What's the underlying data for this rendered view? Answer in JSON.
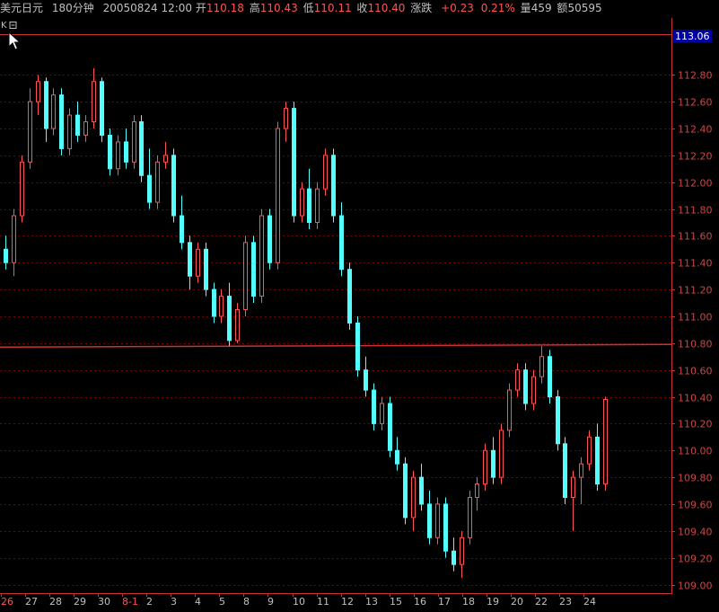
{
  "header": {
    "instrument": "美元日元",
    "period": "180分钟",
    "datetime": "20050824 12:00",
    "open_label": "开",
    "open": "110.18",
    "high_label": "高",
    "high": "110.43",
    "low_label": "低",
    "low": "110.11",
    "close_label": "收",
    "close": "110.40",
    "change_label": "涨跌",
    "change": "+0.23",
    "change_pct": "0.21%",
    "volume_label": "量",
    "volume": "459",
    "amount_label": "额",
    "amount": "50595"
  },
  "toolbar": {
    "k_label": "K",
    "collapse_icon": "minus-box-icon"
  },
  "colors": {
    "up": "#ff5454",
    "down": "#54ffff",
    "grid": "#7a0000",
    "axis": "#c83232",
    "badge_bg": "#0000a0"
  },
  "chart_data": {
    "type": "candlestick",
    "title": "美元日元 180分钟",
    "ylim": [
      108.97,
      113.09
    ],
    "y_ticks": [
      "113.06",
      "112.80",
      "112.60",
      "112.40",
      "112.20",
      "112.00",
      "111.80",
      "111.60",
      "111.40",
      "111.20",
      "111.00",
      "110.80",
      "110.60",
      "110.40",
      "110.20",
      "110.00",
      "109.80",
      "109.60",
      "109.40",
      "109.20",
      "109.00"
    ],
    "current_price_badge": "113.06",
    "x_date_labels": [
      {
        "label": "26",
        "red": true
      },
      {
        "label": "27"
      },
      {
        "label": "28"
      },
      {
        "label": "29"
      },
      {
        "label": "30"
      },
      {
        "label": "8-1",
        "red": true
      },
      {
        "label": "2"
      },
      {
        "label": "3"
      },
      {
        "label": "4"
      },
      {
        "label": "5"
      },
      {
        "label": "8"
      },
      {
        "label": "9"
      },
      {
        "label": "10"
      },
      {
        "label": "11"
      },
      {
        "label": "12"
      },
      {
        "label": "13"
      },
      {
        "label": "15"
      },
      {
        "label": "16"
      },
      {
        "label": "17"
      },
      {
        "label": "18"
      },
      {
        "label": "19"
      },
      {
        "label": "20"
      },
      {
        "label": "22"
      },
      {
        "label": "23"
      },
      {
        "label": "24"
      }
    ],
    "horizontal_line": 110.77,
    "candles": [
      [
        111.5,
        111.6,
        111.35,
        111.4
      ],
      [
        111.4,
        111.8,
        111.3,
        111.75
      ],
      [
        111.75,
        112.2,
        111.7,
        112.15
      ],
      [
        112.15,
        112.7,
        112.1,
        112.6
      ],
      [
        112.6,
        112.8,
        112.5,
        112.75
      ],
      [
        112.75,
        112.78,
        112.3,
        112.4
      ],
      [
        112.4,
        112.7,
        112.35,
        112.65
      ],
      [
        112.65,
        112.7,
        112.2,
        112.25
      ],
      [
        112.25,
        112.55,
        112.2,
        112.5
      ],
      [
        112.5,
        112.6,
        112.3,
        112.35
      ],
      [
        112.35,
        112.5,
        112.3,
        112.45
      ],
      [
        112.45,
        112.85,
        112.4,
        112.75
      ],
      [
        112.75,
        112.78,
        112.3,
        112.35
      ],
      [
        112.35,
        112.4,
        112.05,
        112.1
      ],
      [
        112.1,
        112.35,
        112.05,
        112.3
      ],
      [
        112.3,
        112.4,
        112.1,
        112.15
      ],
      [
        112.15,
        112.5,
        112.1,
        112.45
      ],
      [
        112.45,
        112.5,
        112.0,
        112.05
      ],
      [
        112.05,
        112.25,
        111.8,
        111.85
      ],
      [
        111.85,
        112.2,
        111.8,
        112.15
      ],
      [
        112.15,
        112.3,
        112.1,
        112.2
      ],
      [
        112.2,
        112.25,
        111.7,
        111.75
      ],
      [
        111.75,
        111.9,
        111.5,
        111.55
      ],
      [
        111.55,
        111.6,
        111.2,
        111.3
      ],
      [
        111.3,
        111.55,
        111.25,
        111.5
      ],
      [
        111.5,
        111.55,
        111.15,
        111.2
      ],
      [
        111.2,
        111.25,
        110.95,
        111.0
      ],
      [
        111.0,
        111.2,
        110.95,
        111.15
      ],
      [
        111.15,
        111.25,
        110.78,
        110.82
      ],
      [
        110.82,
        111.1,
        110.8,
        111.05
      ],
      [
        111.05,
        111.6,
        111.0,
        111.55
      ],
      [
        111.55,
        111.6,
        111.1,
        111.15
      ],
      [
        111.15,
        111.8,
        111.1,
        111.75
      ],
      [
        111.75,
        111.8,
        111.35,
        111.4
      ],
      [
        111.4,
        112.45,
        111.35,
        112.4
      ],
      [
        112.4,
        112.6,
        112.3,
        112.55
      ],
      [
        112.55,
        112.6,
        111.7,
        111.75
      ],
      [
        111.75,
        112.0,
        111.7,
        111.95
      ],
      [
        111.95,
        112.1,
        111.65,
        111.7
      ],
      [
        111.7,
        112.0,
        111.65,
        111.95
      ],
      [
        111.95,
        112.25,
        111.9,
        112.2
      ],
      [
        112.2,
        112.25,
        111.7,
        111.75
      ],
      [
        111.75,
        111.85,
        111.3,
        111.35
      ],
      [
        111.35,
        111.4,
        110.9,
        110.95
      ],
      [
        110.95,
        111.0,
        110.55,
        110.6
      ],
      [
        110.6,
        110.7,
        110.4,
        110.45
      ],
      [
        110.45,
        110.5,
        110.15,
        110.2
      ],
      [
        110.2,
        110.4,
        110.15,
        110.35
      ],
      [
        110.35,
        110.4,
        109.95,
        110.0
      ],
      [
        110.0,
        110.1,
        109.85,
        109.9
      ],
      [
        109.9,
        109.95,
        109.45,
        109.5
      ],
      [
        109.5,
        109.85,
        109.4,
        109.8
      ],
      [
        109.8,
        109.9,
        109.55,
        109.6
      ],
      [
        109.6,
        109.7,
        109.3,
        109.35
      ],
      [
        109.35,
        109.65,
        109.3,
        109.6
      ],
      [
        109.6,
        109.65,
        109.2,
        109.25
      ],
      [
        109.25,
        109.35,
        109.1,
        109.15
      ],
      [
        109.15,
        109.4,
        109.05,
        109.35
      ],
      [
        109.35,
        109.7,
        109.3,
        109.65
      ],
      [
        109.65,
        109.8,
        109.55,
        109.75
      ],
      [
        109.75,
        110.05,
        109.7,
        110.0
      ],
      [
        110.0,
        110.1,
        109.75,
        109.8
      ],
      [
        109.8,
        110.2,
        109.75,
        110.15
      ],
      [
        110.15,
        110.5,
        110.1,
        110.45
      ],
      [
        110.45,
        110.65,
        110.4,
        110.6
      ],
      [
        110.6,
        110.65,
        110.3,
        110.35
      ],
      [
        110.35,
        110.6,
        110.3,
        110.55
      ],
      [
        110.55,
        110.78,
        110.5,
        110.7
      ],
      [
        110.7,
        110.75,
        110.35,
        110.4
      ],
      [
        110.4,
        110.45,
        110.0,
        110.05
      ],
      [
        110.05,
        110.1,
        109.6,
        109.65
      ],
      [
        109.65,
        109.85,
        109.4,
        109.8
      ],
      [
        109.8,
        109.95,
        109.6,
        109.9
      ],
      [
        109.9,
        110.15,
        109.85,
        110.1
      ],
      [
        110.1,
        110.2,
        109.7,
        109.75
      ],
      [
        109.75,
        110.4,
        109.7,
        110.38
      ]
    ]
  }
}
